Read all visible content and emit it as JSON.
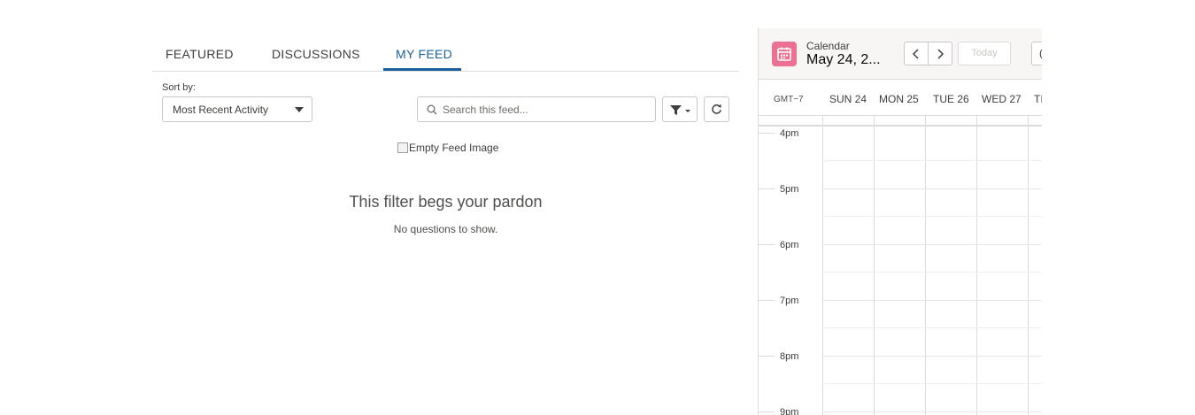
{
  "feed": {
    "tabs": {
      "featured": "FEATURED",
      "discussions": "DISCUSSIONS",
      "my_feed": "MY FEED"
    },
    "sort": {
      "label": "Sort by:",
      "selected": "Most Recent Activity"
    },
    "search": {
      "placeholder": "Search this feed..."
    },
    "empty": {
      "image_alt": "Empty Feed Image",
      "title": "This filter begs your pardon",
      "subtitle": "No questions to show."
    }
  },
  "calendar": {
    "label": "Calendar",
    "date": "May 24, 2...",
    "today_label": "Today",
    "extra_button_glyph": "(",
    "timezone": "GMT−7",
    "days": [
      "SUN 24",
      "MON 25",
      "TUE 26",
      "WED 27",
      "TI"
    ],
    "hours": [
      "4pm",
      "5pm",
      "6pm",
      "7pm",
      "8pm",
      "9pm"
    ]
  },
  "colors": {
    "accent": "#1b5f9e",
    "calendar_icon": "#eb7092"
  },
  "icons": {
    "search": "search-icon",
    "filter": "filter-icon",
    "refresh": "refresh-icon",
    "calendar": "calendar-icon",
    "prev": "chevron-left-icon",
    "next": "chevron-right-icon"
  }
}
